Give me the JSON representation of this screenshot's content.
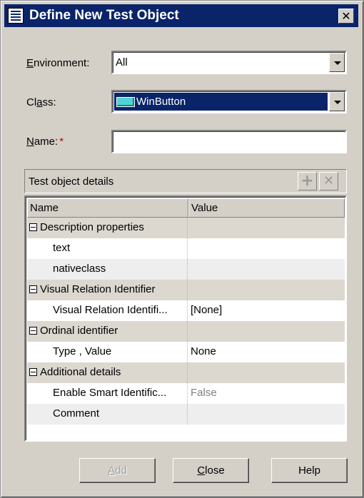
{
  "window": {
    "title": "Define New Test Object",
    "close_glyph": "✕"
  },
  "form": {
    "environment_label_u": "E",
    "environment_label_rest": "nvironment:",
    "environment_value": "All",
    "class_label_pre": "Cl",
    "class_label_u": "a",
    "class_label_rest": "ss:",
    "class_value": "WinButton",
    "name_label_u": "N",
    "name_label_rest": "ame:",
    "name_required": "*",
    "name_value": ""
  },
  "details": {
    "header": "Test object details",
    "add_glyph": "+",
    "remove_glyph": "✕",
    "columns": [
      "Name",
      "Value"
    ],
    "rows": [
      {
        "type": "group",
        "name": "Description properties",
        "value": ""
      },
      {
        "type": "child",
        "name": "text",
        "value": ""
      },
      {
        "type": "child",
        "name": "nativeclass",
        "value": ""
      },
      {
        "type": "group",
        "name": "Visual Relation Identifier",
        "value": ""
      },
      {
        "type": "child",
        "name": "Visual Relation Identifi...",
        "value": "[None]"
      },
      {
        "type": "group",
        "name": "Ordinal identifier",
        "value": ""
      },
      {
        "type": "child",
        "name": "Type , Value",
        "value": "None"
      },
      {
        "type": "group",
        "name": "Additional details",
        "value": ""
      },
      {
        "type": "child",
        "name": "Enable Smart Identific...",
        "value": "False"
      },
      {
        "type": "child",
        "name": "Comment",
        "value": ""
      }
    ]
  },
  "buttons": {
    "add_u": "A",
    "add_rest": "dd",
    "close_u": "C",
    "close_rest": "lose",
    "help": "Help"
  },
  "colors": {
    "titlebar": "#0a246a",
    "dialog_bg": "#d4d0c8",
    "required": "#d40000"
  }
}
